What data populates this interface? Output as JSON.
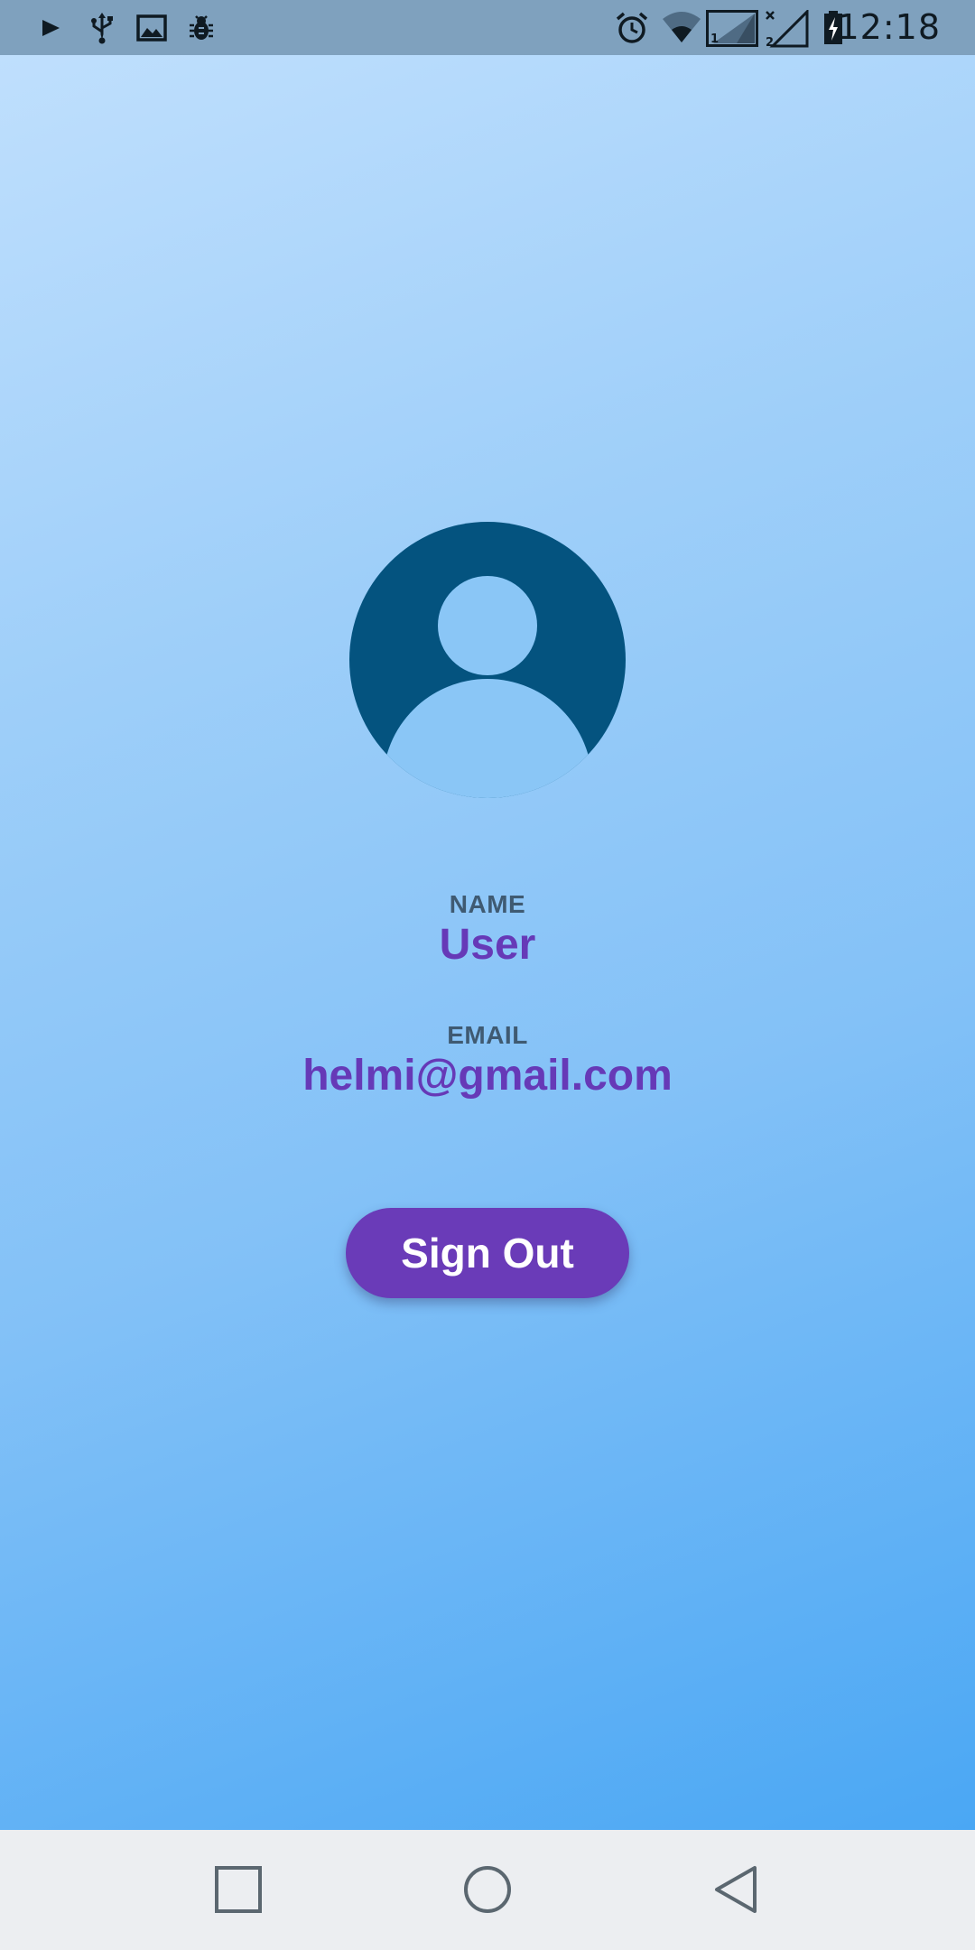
{
  "status_bar": {
    "time": "12:18",
    "left_icons": [
      "play-icon",
      "usb-icon",
      "image-icon",
      "bug-icon"
    ],
    "right_icons": [
      "alarm-icon",
      "wifi-icon",
      "signal-sim1-icon",
      "signal-sim2-icon",
      "battery-icon"
    ]
  },
  "profile": {
    "avatar_icon": "account-circle-icon",
    "name_label": "NAME",
    "name_value": "User",
    "email_label": "EMAIL",
    "email_value": "helmi@gmail.com"
  },
  "actions": {
    "sign_out_label": "Sign Out"
  },
  "nav_bar": {
    "buttons": [
      "recents-icon",
      "home-icon",
      "back-icon"
    ]
  },
  "colors": {
    "status_bar_bg": "#7fa1be",
    "gradient_top": "#bfdffd",
    "gradient_bottom": "#4aa7f4",
    "avatar": "#04537f",
    "label_text": "#3f5a72",
    "accent": "#6639b7",
    "nav_bar_bg": "#eceef1"
  }
}
